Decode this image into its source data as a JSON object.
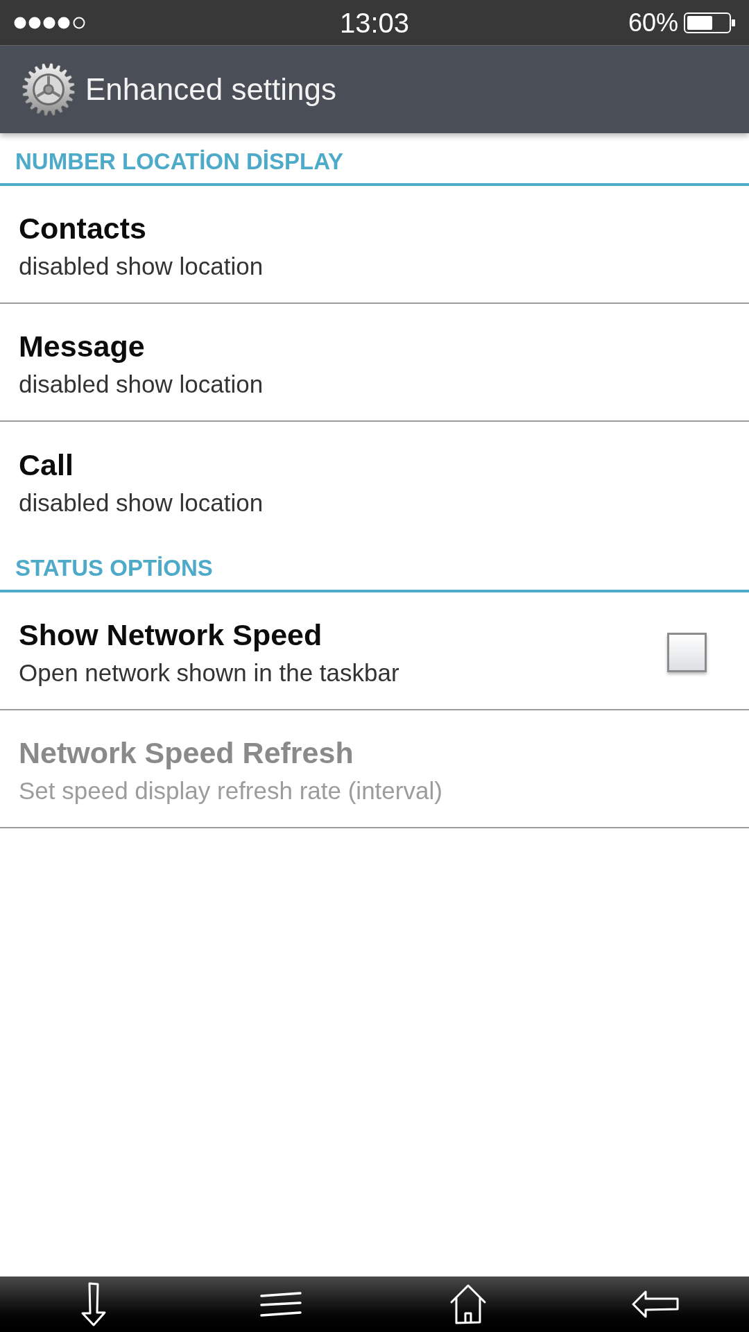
{
  "status_bar": {
    "time": "13:03",
    "battery": "60%"
  },
  "header": {
    "title": "Enhanced settings"
  },
  "sections": [
    {
      "title": "NUMBER LOCATİON DİSPLAY",
      "items": [
        {
          "kind": "plain",
          "title": "Contacts",
          "summary": "disabled show location",
          "disabled": false
        },
        {
          "kind": "plain",
          "title": "Message",
          "summary": "disabled show location",
          "disabled": false
        },
        {
          "kind": "plain",
          "title": "Call",
          "summary": "disabled show location",
          "disabled": false
        }
      ]
    },
    {
      "title": "STATUS OPTİONS",
      "items": [
        {
          "kind": "checkbox",
          "title": "Show Network Speed",
          "summary": "Open network shown in the taskbar",
          "disabled": false,
          "checked": false
        },
        {
          "kind": "plain",
          "title": "Network Speed Refresh",
          "summary": "Set speed display refresh rate (interval)",
          "disabled": true
        }
      ]
    }
  ]
}
